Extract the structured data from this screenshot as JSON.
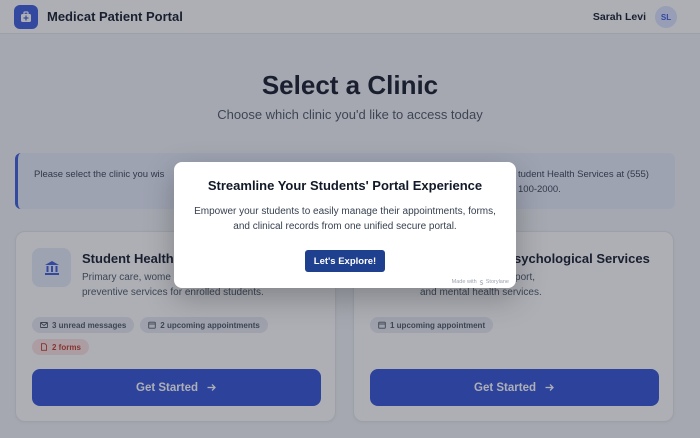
{
  "header": {
    "app_title": "Medicat Patient Portal",
    "user_name": "Sarah Levi",
    "avatar_initials": "SL",
    "brand_color": "#3b5bdb"
  },
  "page": {
    "title": "Select a Clinic",
    "subtitle": "Choose which clinic you'd like to access today"
  },
  "info_banner": {
    "text_left": "Please select the clinic you wis",
    "text_right": "tudent Health Services at (555) 100-2000."
  },
  "clinics": [
    {
      "title": "Student Health",
      "description": "Primary care, wome\npreventive services for enrolled students.",
      "badges": [
        {
          "label": "3 unread messages",
          "icon": "mail-icon",
          "tone": "neutral"
        },
        {
          "label": "2 upcoming appointments",
          "icon": "calendar-icon",
          "tone": "neutral"
        },
        {
          "label": "2 forms",
          "icon": "document-icon",
          "tone": "red"
        }
      ],
      "cta_label": "Get Started",
      "icon": "bank-icon"
    },
    {
      "title": "sychological Services",
      "description": "counseling, crisis support,\nand mental health services.",
      "badges": [
        {
          "label": "1 upcoming appointment",
          "icon": "calendar-icon",
          "tone": "neutral"
        }
      ],
      "cta_label": "Get Started"
    }
  ],
  "modal": {
    "title": "Streamline Your Students' Portal Experience",
    "body": "Empower your students to easily manage their appointments, forms, and clinical records from one unified secure portal.",
    "button_label": "Let's Explore!",
    "made_with": "Made with",
    "made_with_brand": "Storylane"
  }
}
